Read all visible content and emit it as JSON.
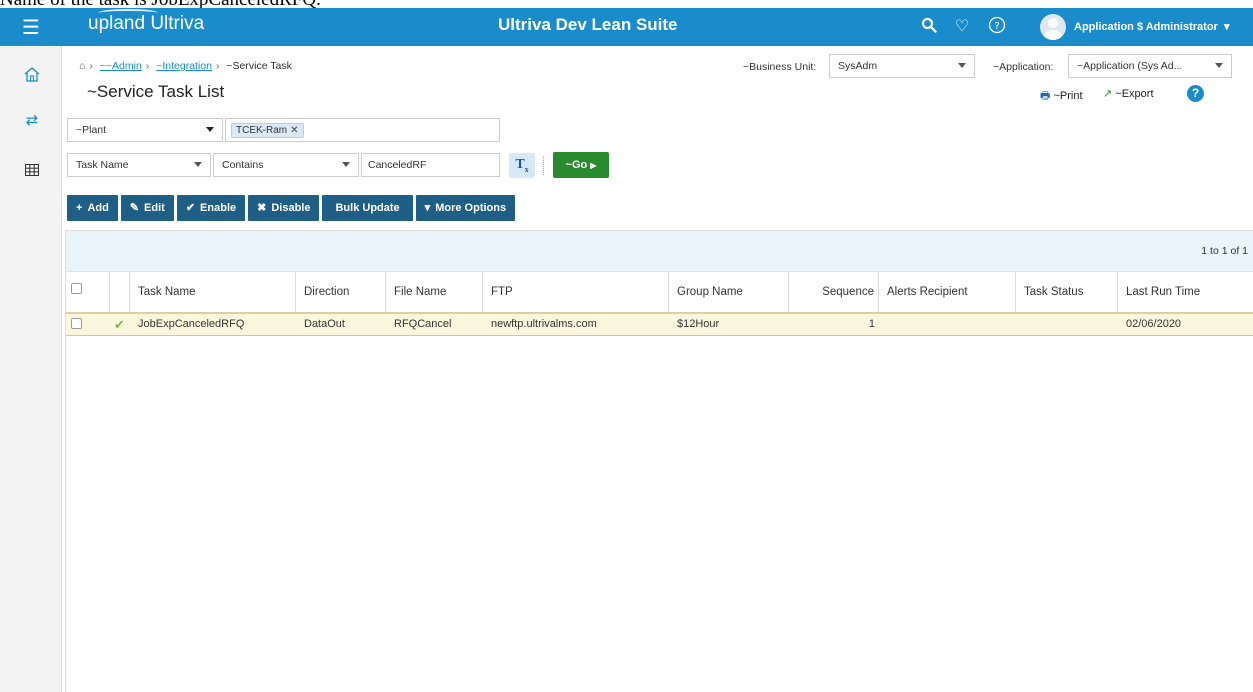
{
  "caption": "Name of the task is JobExpCanceledRFQ.",
  "topbar": {
    "menu_icon": "hamburger-icon",
    "brand": "upland Ultriva",
    "app_title": "Ultriva Dev Lean Suite",
    "icons": [
      "search-icon",
      "heart-icon",
      "help-circle-icon"
    ],
    "user_name": "Application $ Administrator",
    "color": "#1a8ccc"
  },
  "sidebar": {
    "icons": [
      "home-icon",
      "transfer-icon",
      "grid-icon"
    ]
  },
  "breadcrumb": {
    "home_icon": "home-icon",
    "items": [
      "~~Admin",
      "~Integration",
      "~Service Task"
    ]
  },
  "page": {
    "title": "~Service Task List"
  },
  "business_unit": {
    "label": "~Business Unit:",
    "value": "SysAdm"
  },
  "application": {
    "label": "~Application:",
    "value": "~Application (Sys Ad..."
  },
  "header_actions": {
    "print": "~Print",
    "export": "~Export"
  },
  "filters": {
    "plant_field": "~Plant",
    "plant_chip": "TCEK-Ram",
    "field": "Task Name",
    "operator": "Contains",
    "value": "CanceledRF",
    "go": "~Go"
  },
  "toolbar": {
    "add": "Add",
    "edit": "Edit",
    "enable": "Enable",
    "disable": "Disable",
    "bulk_update": "Bulk Update",
    "more_options": "More Options",
    "color": "#1f5f86"
  },
  "grid": {
    "pager": "1 to 1 of 1",
    "columns": [
      "Task Name",
      "Direction",
      "File Name",
      "FTP",
      "Group Name",
      "Sequence",
      "Alerts Recipient",
      "Task Status",
      "Last Run Time"
    ],
    "rows": [
      {
        "task_name": "JobExpCanceledRFQ",
        "direction": "DataOut",
        "file_name": "RFQCancel",
        "ftp": "newftp.ultrivalms.com",
        "group_name": "$12Hour",
        "sequence": "1",
        "alerts_recipient": "",
        "task_status": "",
        "last_run_time": "02/06/2020"
      }
    ]
  }
}
